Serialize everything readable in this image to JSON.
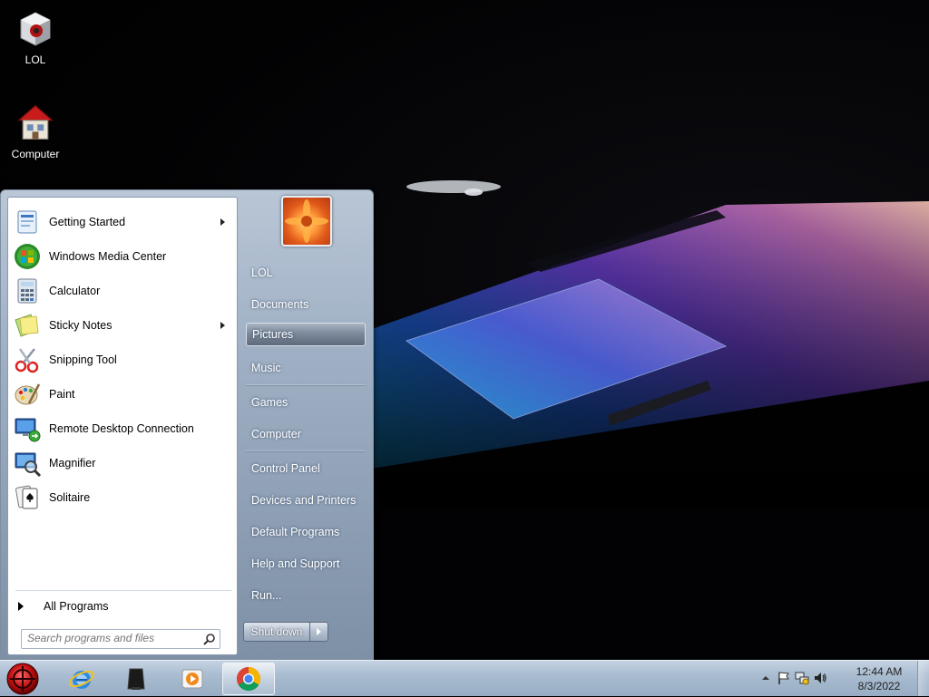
{
  "desktop": {
    "icons": [
      {
        "label": "LOL",
        "icon": "media-player-cube-icon"
      },
      {
        "label": "Computer",
        "icon": "computer-house-icon"
      }
    ]
  },
  "start_menu": {
    "programs": [
      {
        "label": "Getting Started",
        "icon": "getting-started-icon",
        "has_submenu": true
      },
      {
        "label": "Windows Media Center",
        "icon": "windows-media-center-icon",
        "has_submenu": false
      },
      {
        "label": "Calculator",
        "icon": "calculator-icon",
        "has_submenu": false
      },
      {
        "label": "Sticky Notes",
        "icon": "sticky-notes-icon",
        "has_submenu": true
      },
      {
        "label": "Snipping Tool",
        "icon": "snipping-tool-icon",
        "has_submenu": false
      },
      {
        "label": "Paint",
        "icon": "paint-icon",
        "has_submenu": false
      },
      {
        "label": "Remote Desktop Connection",
        "icon": "remote-desktop-icon",
        "has_submenu": false
      },
      {
        "label": "Magnifier",
        "icon": "magnifier-icon",
        "has_submenu": false
      },
      {
        "label": "Solitaire",
        "icon": "solitaire-icon",
        "has_submenu": false
      }
    ],
    "all_programs_label": "All Programs",
    "search_placeholder": "Search programs and files",
    "places": [
      {
        "label": "LOL"
      },
      {
        "label": "Documents"
      },
      {
        "label": "Pictures",
        "hovered": true
      },
      {
        "label": "Music"
      },
      {
        "label": "Games"
      },
      {
        "label": "Computer"
      },
      {
        "label": "Control Panel"
      },
      {
        "label": "Devices and Printers"
      },
      {
        "label": "Default Programs"
      },
      {
        "label": "Help and Support"
      },
      {
        "label": "Run..."
      }
    ],
    "shutdown_label": "Shut down"
  },
  "taskbar": {
    "pinned": [
      {
        "icon": "internet-explorer-icon"
      },
      {
        "icon": "device-tower-icon"
      },
      {
        "icon": "media-player-icon"
      },
      {
        "icon": "chrome-icon",
        "active": true
      }
    ],
    "tray": {
      "icons": [
        "show-hidden-icons-icon",
        "action-center-flag-icon",
        "network-icon",
        "volume-icon"
      ],
      "time": "12:44 AM",
      "date": "8/3/2022"
    }
  }
}
